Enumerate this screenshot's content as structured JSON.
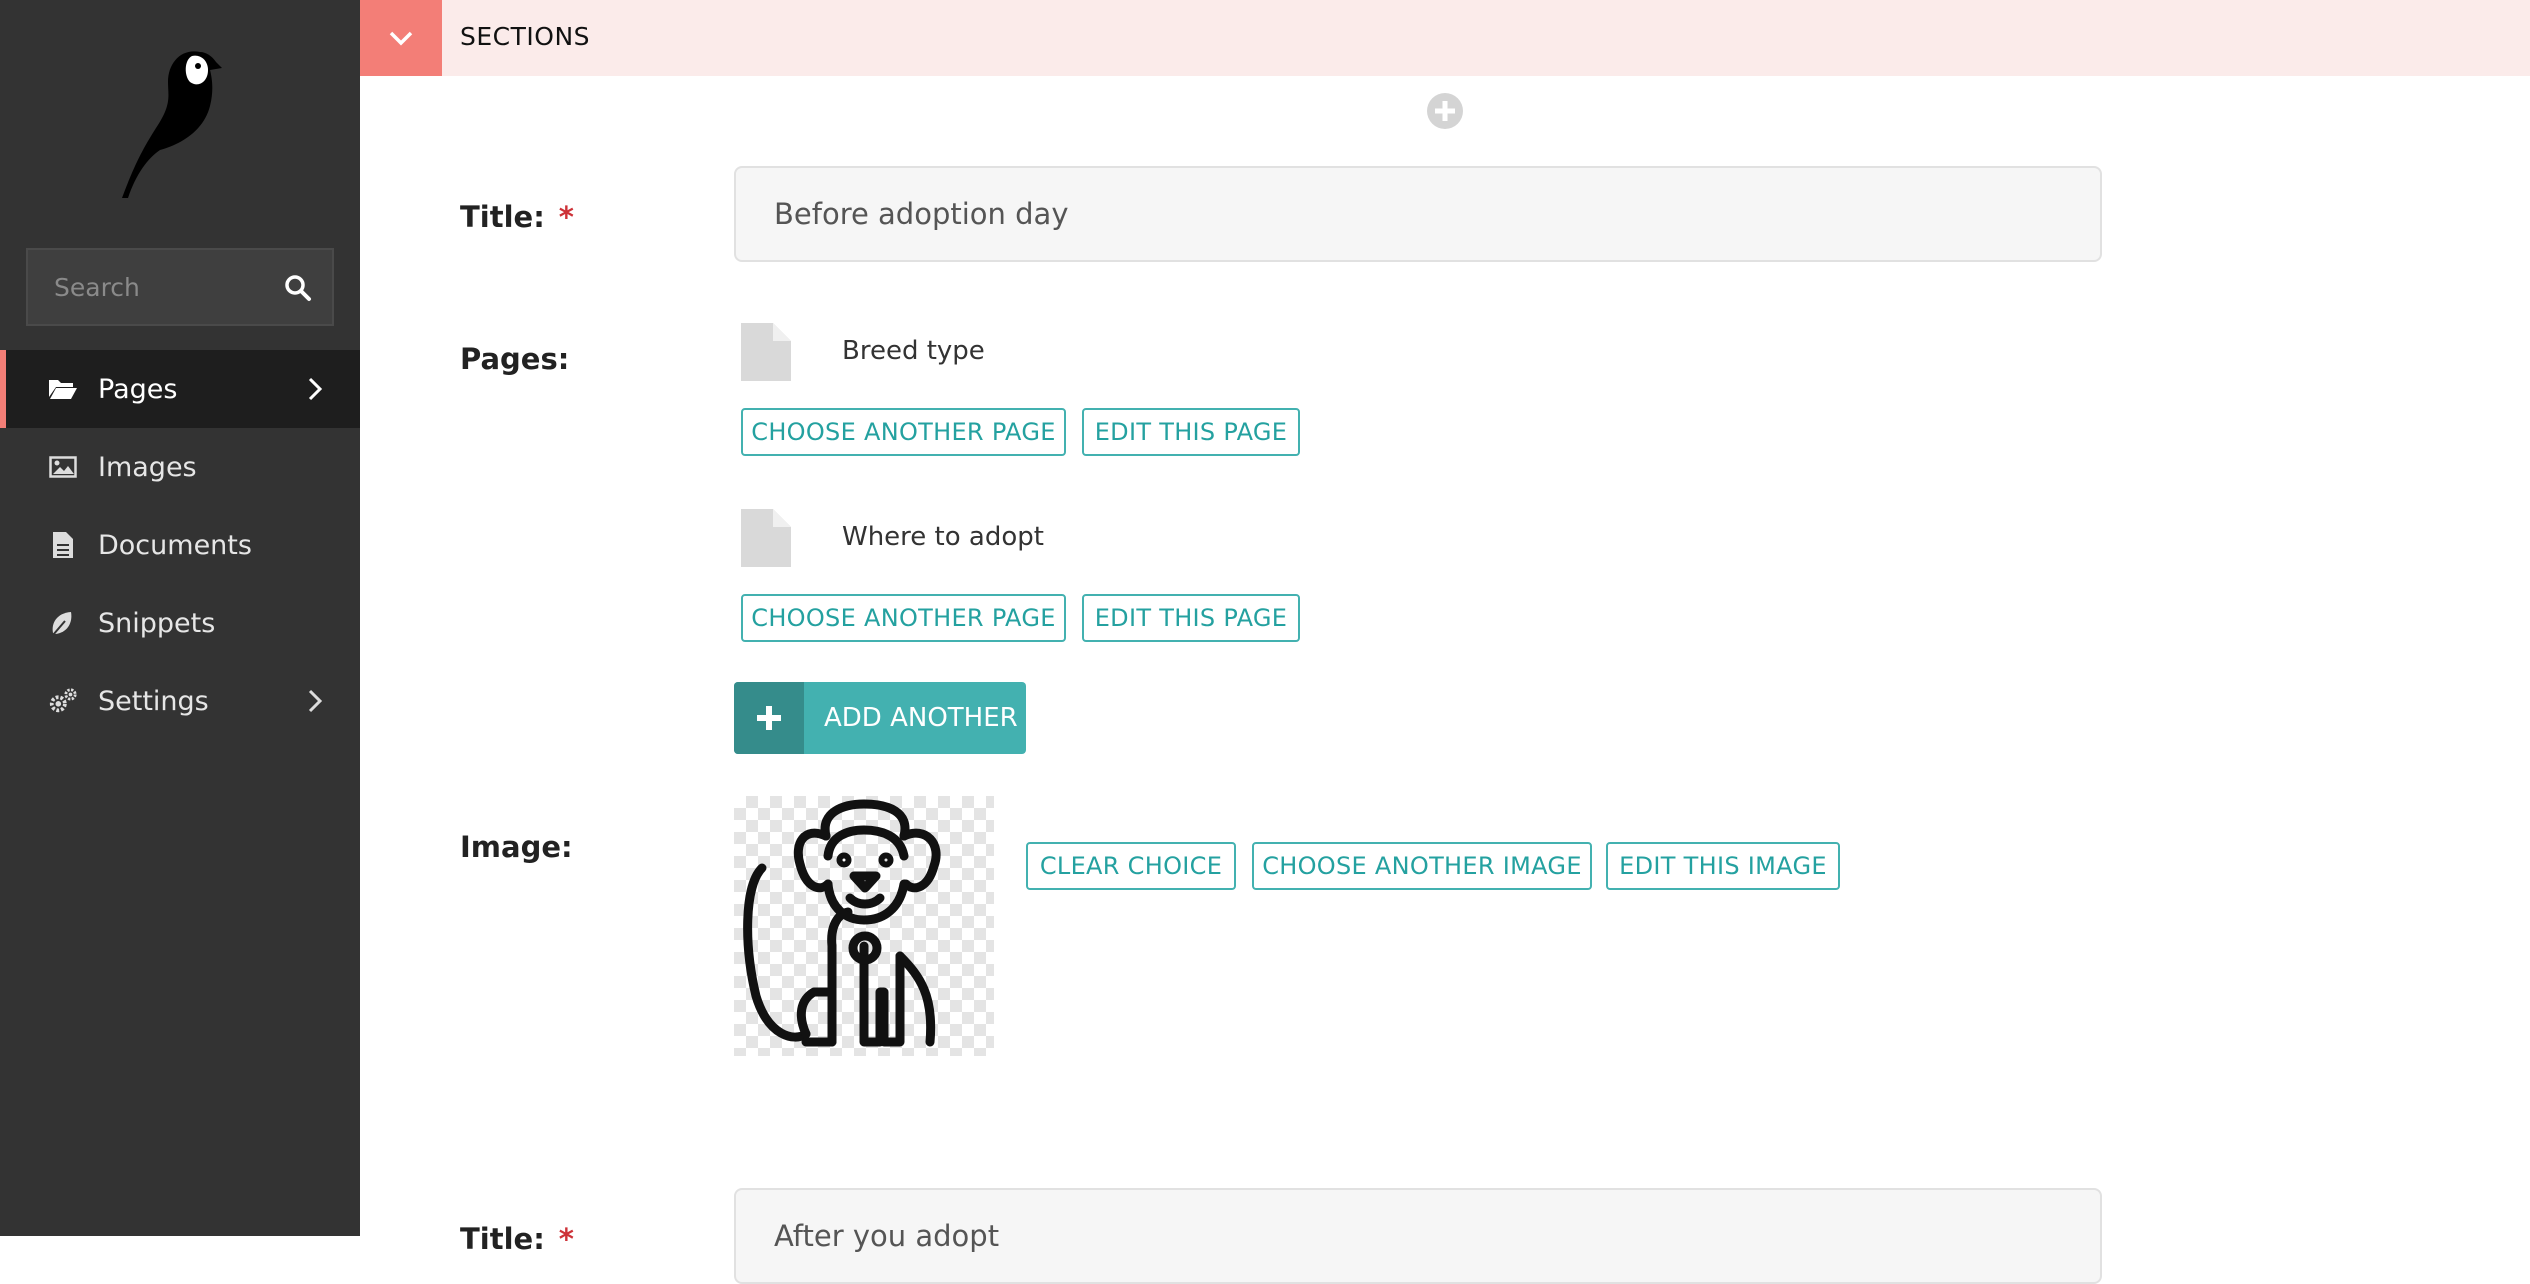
{
  "sidebar": {
    "logo": "wagtail-bird-logo",
    "search": {
      "placeholder": "Search"
    },
    "items": [
      {
        "label": "Pages",
        "icon": "folder-open-icon",
        "active": true,
        "has_submenu": true
      },
      {
        "label": "Images",
        "icon": "image-icon",
        "active": false,
        "has_submenu": false
      },
      {
        "label": "Documents",
        "icon": "document-icon",
        "active": false,
        "has_submenu": false
      },
      {
        "label": "Snippets",
        "icon": "snippets-icon",
        "active": false,
        "has_submenu": false
      },
      {
        "label": "Settings",
        "icon": "cogs-icon",
        "active": false,
        "has_submenu": true
      }
    ]
  },
  "section_header": {
    "label": "SECTIONS"
  },
  "block": {
    "title_label": "Title:",
    "required_marker": "*",
    "title_value": "Before adoption day",
    "pages_label": "Pages:",
    "pages": [
      {
        "name": "Breed type",
        "choose_label": "CHOOSE ANOTHER PAGE",
        "edit_label": "EDIT THIS PAGE"
      },
      {
        "name": "Where to adopt",
        "choose_label": "CHOOSE ANOTHER PAGE",
        "edit_label": "EDIT THIS PAGE"
      }
    ],
    "add_another_label": "ADD ANOTHER",
    "image_label": "Image:",
    "image_alt": "dog-outline-image",
    "clear_choice_label": "CLEAR CHOICE",
    "choose_image_label": "CHOOSE ANOTHER IMAGE",
    "edit_image_label": "EDIT THIS IMAGE"
  },
  "next_block": {
    "title_label": "Title:",
    "title_value": "After you adopt"
  },
  "colors": {
    "sidebar_bg": "#333333",
    "accent_coral": "#f37e77",
    "teal": "#43b1b0",
    "required_red": "#cd3238"
  }
}
